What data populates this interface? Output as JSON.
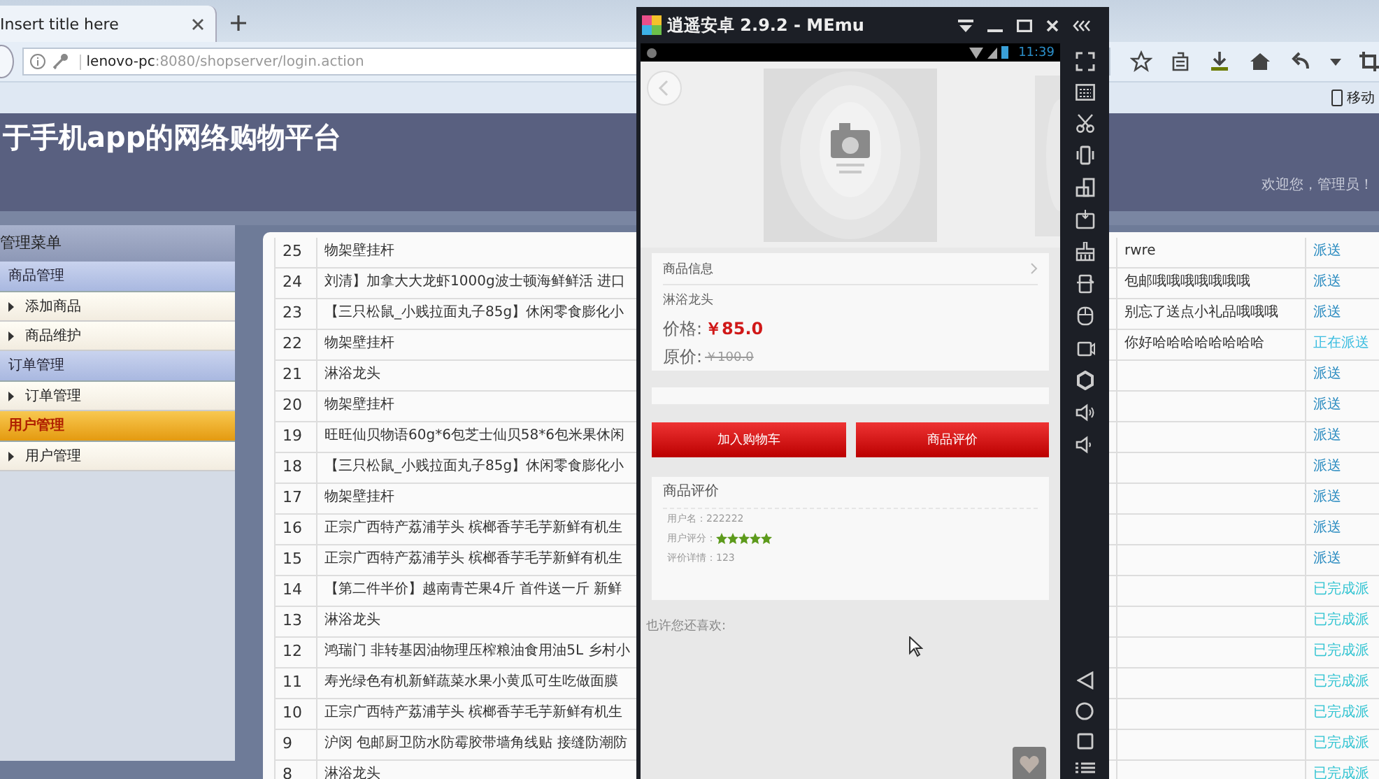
{
  "browser": {
    "tab_title": "Insert title here",
    "url_host": "lenovo-pc",
    "url_path": ":8080/shopserver/login.action",
    "bookmark": "移动"
  },
  "header": {
    "title": "于手机app的网络购物平台",
    "welcome": "欢迎您，管理员！"
  },
  "menu": {
    "title": "管理菜单",
    "groups": [
      {
        "label": "商品管理",
        "selected": false,
        "items": [
          {
            "label": "添加商品"
          },
          {
            "label": "商品维护"
          }
        ]
      },
      {
        "label": "订单管理",
        "selected": false,
        "items": [
          {
            "label": "订单管理"
          }
        ]
      },
      {
        "label": "用户管理",
        "selected": true,
        "items": [
          {
            "label": "用户管理"
          }
        ]
      }
    ]
  },
  "orders": [
    {
      "id": "25",
      "name": "物架壁挂杆",
      "note": "rwre",
      "status": "派送",
      "kind": "pending"
    },
    {
      "id": "24",
      "name": "刘清】加拿大大龙虾1000g波士顿海鲜鲜活 进口",
      "note": "包邮哦哦哦哦哦哦哦",
      "status": "派送",
      "kind": "pending"
    },
    {
      "id": "23",
      "name": "【三只松鼠_小贱拉面丸子85g】休闲零食膨化小",
      "note": "别忘了送点小礼品哦哦哦",
      "status": "派送",
      "kind": "pending"
    },
    {
      "id": "22",
      "name": "物架壁挂杆",
      "note": "你好哈哈哈哈哈哈哈哈",
      "status": "正在派送",
      "kind": "shipping"
    },
    {
      "id": "21",
      "name": "淋浴龙头",
      "status": "派送",
      "kind": "pending"
    },
    {
      "id": "20",
      "name": "物架壁挂杆",
      "status": "派送",
      "kind": "pending"
    },
    {
      "id": "19",
      "name": "旺旺仙贝物语60g*6包芝士仙贝58*6包米果休闲",
      "status": "派送",
      "kind": "pending"
    },
    {
      "id": "18",
      "name": "【三只松鼠_小贱拉面丸子85g】休闲零食膨化小",
      "status": "派送",
      "kind": "pending"
    },
    {
      "id": "17",
      "name": "物架壁挂杆",
      "status": "派送",
      "kind": "pending"
    },
    {
      "id": "16",
      "name": "正宗广西特产荔浦芋头 槟榔香芋毛芋新鲜有机生",
      "status": "派送",
      "kind": "pending"
    },
    {
      "id": "15",
      "name": "正宗广西特产荔浦芋头 槟榔香芋毛芋新鲜有机生",
      "status": "派送",
      "kind": "pending"
    },
    {
      "id": "14",
      "name": "【第二件半价】越南青芒果4斤 首件送一斤 新鲜",
      "status": "已完成派",
      "kind": "done"
    },
    {
      "id": "13",
      "name": "淋浴龙头",
      "status": "已完成派",
      "kind": "done"
    },
    {
      "id": "12",
      "name": "鸿瑞门 非转基因油物理压榨粮油食用油5L 乡村小",
      "status": "已完成派",
      "kind": "done"
    },
    {
      "id": "11",
      "name": "寿光绿色有机新鲜蔬菜水果小黄瓜可生吃做面膜",
      "status": "已完成派",
      "kind": "done"
    },
    {
      "id": "10",
      "name": "正宗广西特产荔浦芋头 槟榔香芋毛芋新鲜有机生",
      "status": "已完成派",
      "kind": "done"
    },
    {
      "id": "9",
      "name": "沪闵 包邮厨卫防水防霉胶带墙角线贴 接缝防潮防",
      "status": "已完成派",
      "kind": "done"
    },
    {
      "id": "8",
      "name": "淋浴龙头",
      "status": "已完成派",
      "kind": "done"
    }
  ],
  "emulator": {
    "title": "逍遥安卓 2.9.2 - MEmu",
    "time": "11:39",
    "product": {
      "section": "商品信息",
      "name": "淋浴龙头",
      "price_label": "价格:",
      "price": "￥85.0",
      "original_label": "原价:",
      "original_price": "￥100.0"
    },
    "buttons": [
      "加入购物车",
      "商品评价"
    ],
    "review": {
      "title": "商品评价",
      "user_label": "用户名：",
      "user": "222222",
      "rating_label": "用户评分：",
      "stars": 5,
      "detail_label": "评价详情：",
      "detail": "123"
    },
    "recommend": "也许您还喜欢:"
  }
}
